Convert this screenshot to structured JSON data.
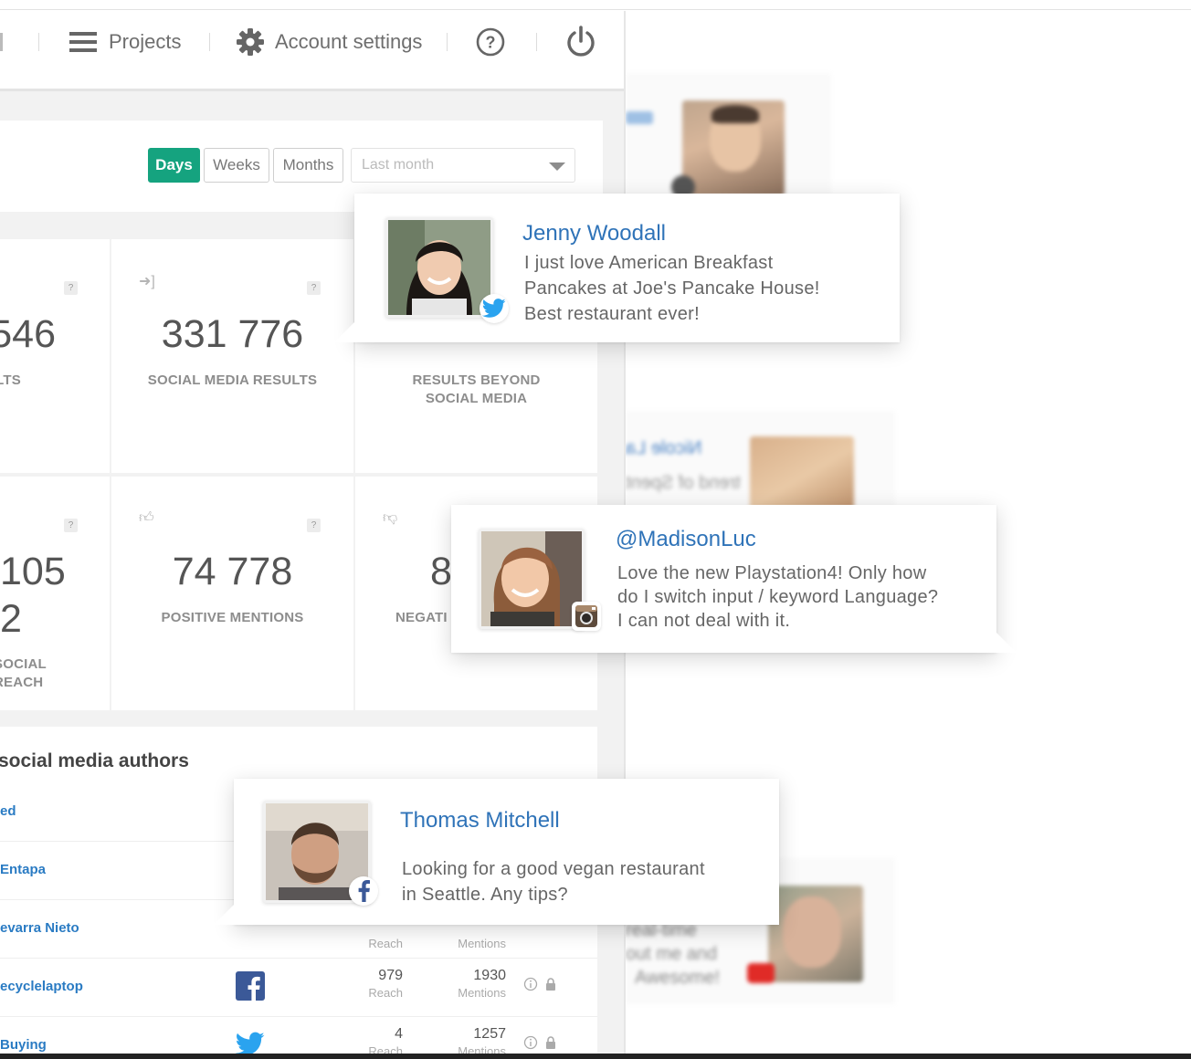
{
  "topbar": {
    "projects_label": "Projects",
    "account_label": "Account settings"
  },
  "filters": {
    "days": "Days",
    "weeks": "Weeks",
    "months": "Months",
    "period_placeholder": "Last month"
  },
  "stats": [
    {
      "value": "546",
      "caption": "LTS"
    },
    {
      "value": "331 776",
      "caption": "SOCIAL MEDIA RESULTS"
    },
    {
      "value": "",
      "caption": "RESULTS BEYOND SOCIAL MEDIA"
    },
    {
      "value": "105",
      "value2": "2",
      "caption": "SOCIAL REACH"
    },
    {
      "value": "74 778",
      "caption": "POSITIVE MENTIONS"
    },
    {
      "value": "8",
      "caption": "NEGATI"
    }
  ],
  "authors": {
    "title": "social media authors",
    "rows": [
      {
        "name": "ed",
        "network": "",
        "reach": "",
        "reach_label": "",
        "mentions": "",
        "mentions_label": ""
      },
      {
        "name": "Entapa",
        "network": "",
        "reach": "",
        "reach_label": "",
        "mentions": "",
        "mentions_label": ""
      },
      {
        "name": "evarra Nieto",
        "network": "",
        "reach": "",
        "reach_label": "Reach",
        "mentions": "",
        "mentions_label": "Mentions"
      },
      {
        "name": "ecyclelaptop",
        "network": "facebook",
        "reach": "979",
        "reach_label": "Reach",
        "mentions": "1930",
        "mentions_label": "Mentions"
      },
      {
        "name": "Buying",
        "network": "twitter",
        "reach": "4",
        "reach_label": "Reach",
        "mentions": "1257",
        "mentions_label": "Mentions"
      }
    ]
  },
  "background_feed": {
    "snippet_1": "Nicole La",
    "snippet_2": "trend of Spent",
    "snippet_3": "real-time",
    "snippet_4": "out me and",
    "snippet_5": "Awesome!"
  },
  "popups": [
    {
      "name": "Jenny Woodall",
      "network": "twitter",
      "message_lines": [
        "I just love American Breakfast",
        "Pancakes at Joe's Pancake House!",
        "Best restaurant ever!"
      ]
    },
    {
      "name": "@MadisonLuc",
      "network": "instagram",
      "message_lines": [
        "Love the new Playstation4! Only how",
        "do I switch input / keyword Language?",
        "I can not deal with it."
      ]
    },
    {
      "name": "Thomas Mitchell",
      "network": "facebook",
      "message_lines": [
        "Looking for a good vegan restaurant",
        "in Seattle. Any tips?"
      ]
    }
  ],
  "colors": {
    "accent_green": "#15a37f",
    "link_blue": "#2f73b8",
    "twitter_blue": "#1da1f2",
    "facebook_blue": "#3b5998"
  }
}
